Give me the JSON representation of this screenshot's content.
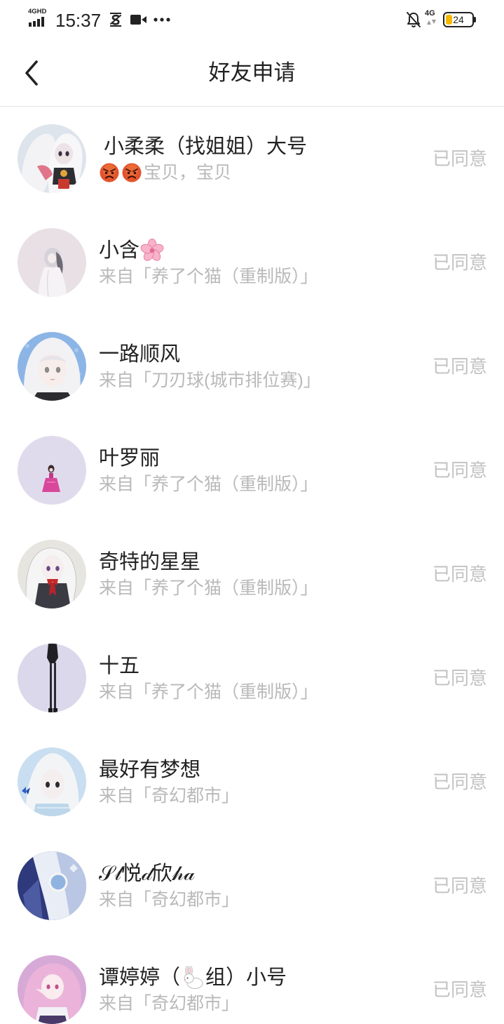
{
  "status_bar": {
    "signal_label": "4GHD",
    "time": "15:37",
    "icons_left": [
      "signal-bars-icon",
      "screenshot-icon",
      "video-icon",
      "more-dots-icon"
    ],
    "icons_right": [
      "bell-off-icon",
      "data-arrows-icon"
    ],
    "network": "4G",
    "battery": "24",
    "battery_color": "#f5b800"
  },
  "header": {
    "back_icon": "chevron-left-icon",
    "title": "好友申请"
  },
  "requests": [
    {
      "name": "小柔柔（找姐姐）大号",
      "subtitle_icons": [
        "angry-face-icon",
        "angry-face-icon"
      ],
      "subtitle": "宝贝，宝贝",
      "status": "已同意"
    },
    {
      "name": "小含",
      "name_icon": "cherry-blossom-icon",
      "subtitle": "来自「养了个猫（重制版）」",
      "status": "已同意"
    },
    {
      "name": "一路顺风",
      "subtitle": "来自「刀刃球(城市排位赛)」",
      "status": "已同意"
    },
    {
      "name": "叶罗丽",
      "subtitle": "来自「养了个猫（重制版）」",
      "status": "已同意"
    },
    {
      "name": "奇特的星星",
      "subtitle": "来自「养了个猫（重制版）」",
      "status": "已同意"
    },
    {
      "name": "十五",
      "subtitle": "来自「养了个猫（重制版）」",
      "status": "已同意"
    },
    {
      "name": "最好有梦想",
      "subtitle": "来自「奇幻都市」",
      "status": "已同意"
    },
    {
      "name": "𝒮𝓁悦𝒹欣𝒽𝒶",
      "subtitle": "来自「奇幻都市」",
      "status": "已同意"
    },
    {
      "name": "谭婷婷（",
      "name_icon": "rabbit-icon",
      "name_after_icon": "组）小号",
      "subtitle": "来自「奇幻都市」",
      "status": "已同意"
    }
  ],
  "colors": {
    "text": "#222222",
    "secondary_text": "#b9b9b9",
    "status_text": "#c2c2c2",
    "divider": "#e6e6e6",
    "background": "#ffffff"
  }
}
